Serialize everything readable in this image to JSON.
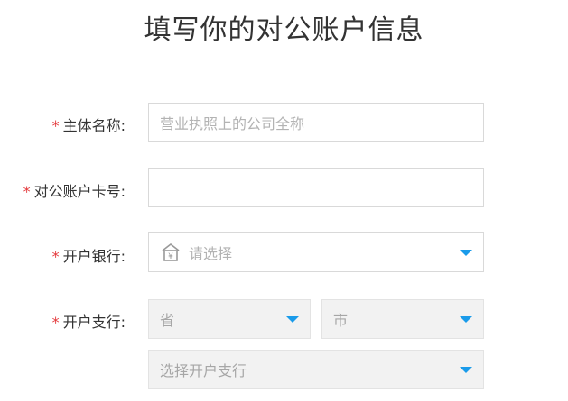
{
  "title": "填写你的对公账户信息",
  "colors": {
    "required": "#e4393c",
    "caret": "#1a9bea",
    "border": "#d9d9d9"
  },
  "form": {
    "company_name": {
      "label": "主体名称:",
      "required_mark": "*",
      "placeholder": "营业执照上的公司全称",
      "value": ""
    },
    "account_number": {
      "label": "对公账户卡号:",
      "required_mark": "*",
      "placeholder": "",
      "value": ""
    },
    "bank": {
      "label": "开户银行:",
      "required_mark": "*",
      "icon": "bank-icon",
      "placeholder": "请选择"
    },
    "branch": {
      "label": "开户支行:",
      "required_mark": "*",
      "province_placeholder": "省",
      "city_placeholder": "市",
      "branch_placeholder": "选择开户支行"
    }
  }
}
